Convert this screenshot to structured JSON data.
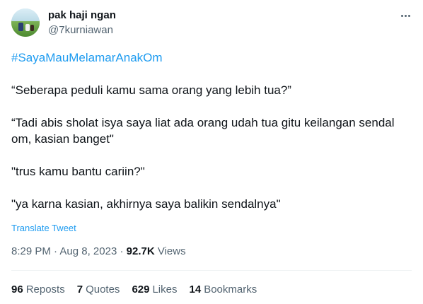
{
  "author": {
    "display_name": "pak haji ngan",
    "handle": "@7kurniawan",
    "avatar_icon": "profile-photo"
  },
  "tweet": {
    "hashtag": "#SayaMauMelamarAnakOm",
    "lines": [
      "“Seberapa peduli kamu sama orang yang lebih tua?”",
      "“Tadi abis sholat isya saya liat ada orang udah tua gitu keilangan sendal",
      "om, kasian banget\"",
      "\"trus kamu bantu cariin?\"",
      "\"ya karna kasian, akhirnya saya balikin sendalnya\""
    ],
    "translate_label": "Translate Tweet"
  },
  "meta": {
    "time": "8:29 PM",
    "separator": "·",
    "date": "Aug 8, 2023",
    "views_count": "92.7K",
    "views_label": "Views"
  },
  "stats": {
    "reposts_count": "96",
    "reposts_label": "Reposts",
    "quotes_count": "7",
    "quotes_label": "Quotes",
    "likes_count": "629",
    "likes_label": "Likes",
    "bookmarks_count": "14",
    "bookmarks_label": "Bookmarks"
  },
  "colors": {
    "link": "#1d9bf0",
    "secondary_text": "#536471",
    "primary_text": "#0f1419"
  }
}
